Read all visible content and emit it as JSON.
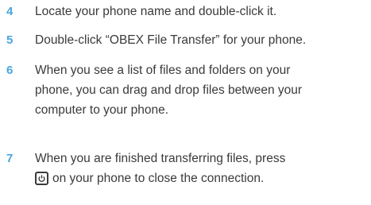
{
  "colors": {
    "step_number": "#47a6df",
    "body_text": "#3a3a3a",
    "background": "#ffffff"
  },
  "steps": [
    {
      "number": "4",
      "lines": [
        "Locate your phone name and double-click it."
      ]
    },
    {
      "number": "5",
      "lines": [
        "Double-click “OBEX File Transfer” for your phone."
      ]
    },
    {
      "number": "6",
      "lines": [
        "When you see a list of files and folders on your",
        "phone, you can drag and drop files between your",
        "computer to your phone."
      ]
    },
    {
      "number": "7",
      "lines": [
        "When you are finished transferring files, press",
        "on your phone to close the connection."
      ],
      "icon": "end-power-key-icon"
    }
  ]
}
